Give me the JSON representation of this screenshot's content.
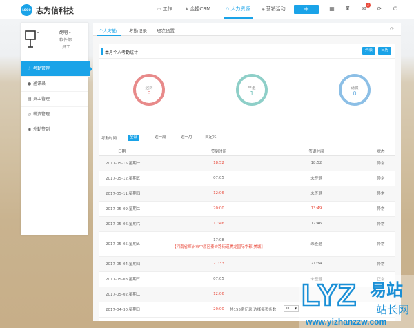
{
  "header": {
    "logo_text": "LOGO",
    "brand": "志为信科技",
    "nav": [
      {
        "label": "工作",
        "icon": "briefcase-icon"
      },
      {
        "label": "企捷CRM",
        "icon": "crm-icon"
      },
      {
        "label": "人力资源",
        "icon": "people-icon",
        "active": true
      },
      {
        "label": "营销活动",
        "icon": "megaphone-icon"
      }
    ],
    "plus_label": "+",
    "mail_badge": "4"
  },
  "sidebar": {
    "user_name": "胡明 ▾",
    "user_dept": "软件部",
    "user_role": "员工",
    "menu": [
      {
        "label": "考勤管理",
        "icon": "hand-icon",
        "active": true
      },
      {
        "label": "通讯录",
        "icon": "contact-icon"
      },
      {
        "label": "员工管理",
        "icon": "staff-icon"
      },
      {
        "label": "薪资管理",
        "icon": "salary-icon"
      },
      {
        "label": "外勤签到",
        "icon": "location-icon"
      }
    ]
  },
  "tabs": [
    {
      "label": "个人考勤",
      "active": true
    },
    {
      "label": "考勤记录"
    },
    {
      "label": "班次设置"
    }
  ],
  "card": {
    "title": "本月个人考勤统计",
    "view_list": "列表",
    "view_calendar": "日历"
  },
  "stats": [
    {
      "label": "迟到",
      "value": "8",
      "color": "#e88a8a"
    },
    {
      "label": "早退",
      "value": "1",
      "color": "#8ecfc8"
    },
    {
      "label": "请假",
      "value": "0",
      "color": "#8cbfe6"
    }
  ],
  "filter": {
    "label": "考勤时间：",
    "options": [
      "全部",
      "近一周",
      "近一月",
      "自定义"
    ]
  },
  "table": {
    "headers": [
      "日期",
      "签到时间",
      "签退时间",
      "状态"
    ],
    "rows": [
      {
        "date": "2017-05-15,星期一",
        "in": "18:52",
        "in_late": true,
        "addr": "",
        "out": "18:52",
        "out_late": false,
        "status": "异常"
      },
      {
        "date": "2017-05-12,星期五",
        "in": "07:05",
        "in_late": false,
        "addr": "",
        "out": "未签退",
        "out_late": false,
        "status": "异常"
      },
      {
        "date": "2017-05-11,星期四",
        "in": "12:06",
        "in_late": true,
        "addr": "",
        "out": "未签退",
        "out_late": false,
        "status": "异常"
      },
      {
        "date": "2017-05-09,星期二",
        "in": "20:00",
        "in_late": true,
        "addr": "",
        "out": "13:49",
        "out_late": true,
        "status": "异常"
      },
      {
        "date": "2017-05-06,星期六",
        "in": "17:46",
        "in_late": true,
        "addr": "",
        "out": "17:46",
        "out_late": false,
        "status": "异常"
      },
      {
        "date": "2017-05-05,星期五",
        "in": "17:08",
        "in_late": false,
        "addr": "【河南省郑州市中原区秦岭路街道腾龙国际华都·美城】",
        "out": "未签退",
        "out_late": false,
        "status": "异常"
      },
      {
        "date": "2017-05-04,星期四",
        "in": "21:33",
        "in_late": true,
        "addr": "",
        "out": "21:34",
        "out_late": false,
        "status": "异常"
      },
      {
        "date": "2017-05-03,星期三",
        "in": "07:05",
        "in_late": false,
        "addr": "",
        "out": "未签退",
        "out_late": false,
        "status": "正常"
      },
      {
        "date": "2017-05-02,星期二",
        "in": "12:06",
        "in_late": true,
        "addr": "",
        "out": "",
        "out_late": false,
        "status": ""
      },
      {
        "date": "2017-04-30,星期日",
        "in": "20:00",
        "in_late": true,
        "addr": "",
        "out": "",
        "out_late": false,
        "status": ""
      }
    ]
  },
  "pager": {
    "text": "共155条记录 选择每页条数",
    "page_size": "10"
  },
  "watermark": {
    "main": "LYZ",
    "cn1": "易站",
    "cn2": "站长网",
    "url": "www.yizhanzzw.com"
  }
}
